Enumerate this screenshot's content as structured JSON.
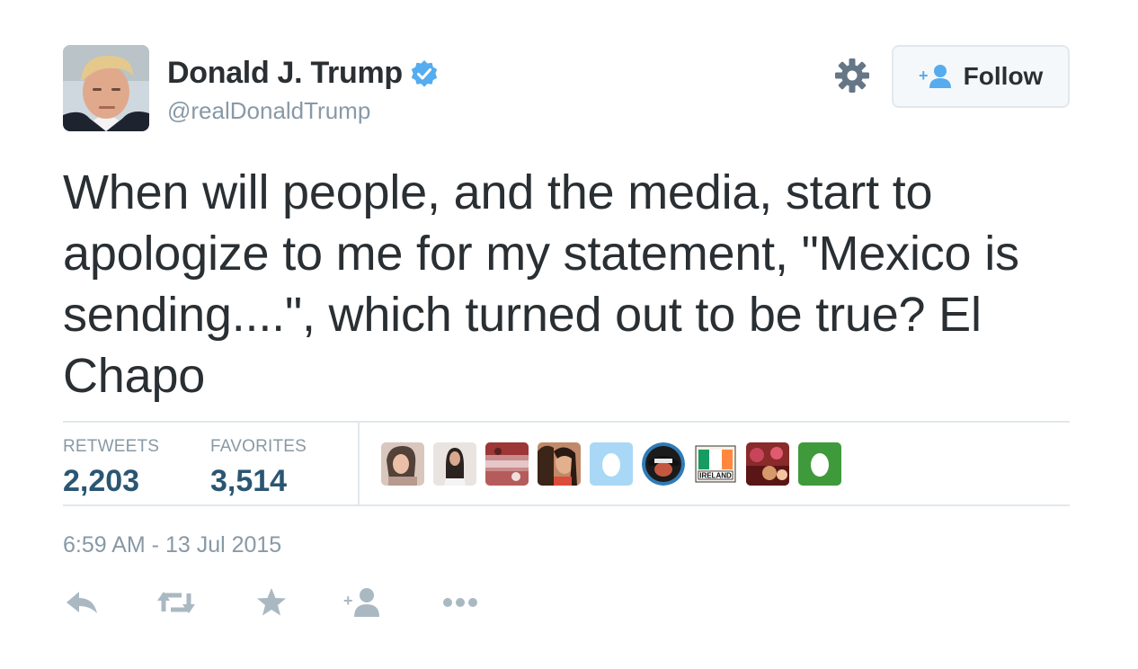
{
  "user": {
    "display_name": "Donald J. Trump",
    "screen_name": "@realDonaldTrump",
    "verified": true
  },
  "follow_button": {
    "label": "Follow"
  },
  "tweet": {
    "text": "When will people, and the media, start to apologize to me for my statement, \"Mexico is sending....\", which turned out to be true?  El Chapo"
  },
  "stats": {
    "retweets_label": "RETWEETS",
    "retweets_value": "2,203",
    "favorites_label": "FAVORITES",
    "favorites_value": "3,514"
  },
  "favoriters": [
    {
      "icon": "user-photo"
    },
    {
      "icon": "user-photo"
    },
    {
      "icon": "user-photo"
    },
    {
      "icon": "user-photo"
    },
    {
      "icon": "default-egg"
    },
    {
      "icon": "user-photo"
    },
    {
      "icon": "flag-ireland",
      "label": "IRELAND"
    },
    {
      "icon": "user-photo"
    },
    {
      "icon": "default-egg"
    }
  ],
  "timestamp": "6:59 AM - 13 Jul 2015",
  "actions": [
    "reply-icon",
    "retweet-icon",
    "favorite-icon",
    "follow-icon",
    "more-icon"
  ],
  "colors": {
    "text": "#292f33",
    "muted": "#8899a6",
    "verified_blue": "#55acee",
    "stat_value": "#2a5672",
    "border": "#e1e8ed",
    "action_gray": "#aab8c2"
  }
}
